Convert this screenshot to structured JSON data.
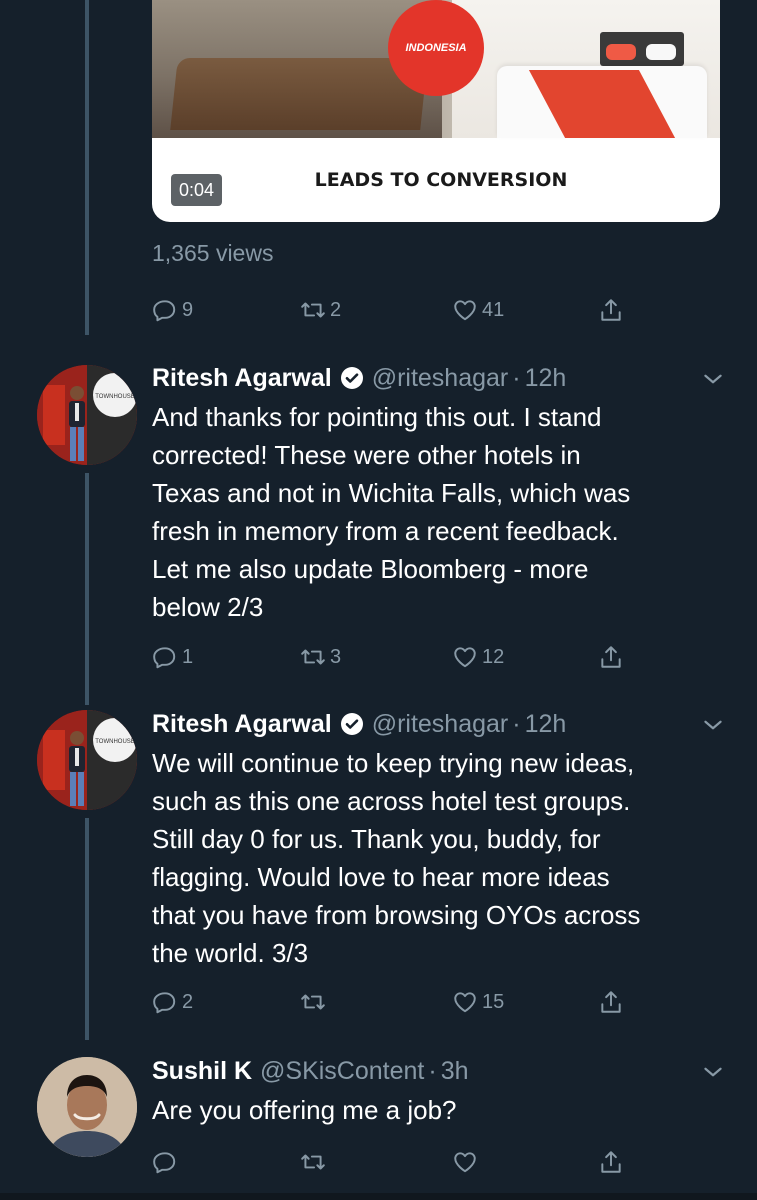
{
  "video": {
    "badge_text": "INDONESIA",
    "caption": "LEADS TO CONVERSION",
    "duration": "0:04",
    "views": "1,365 views"
  },
  "tweets": [
    {
      "replies": "9",
      "retweets": "2",
      "likes": "41"
    },
    {
      "name": "Ritesh Agarwal",
      "handle": "@riteshagar",
      "dot": "·",
      "time": "12h",
      "avatar_sign": "TOWNHOUSE",
      "text": "And thanks for pointing this out. I stand\ncorrected! These were other hotels in\nTexas and not in Wichita Falls, which was\nfresh in memory from a recent feedback.\nLet me also update Bloomberg - more\nbelow 2/3",
      "replies": "1",
      "retweets": "3",
      "likes": "12"
    },
    {
      "name": "Ritesh Agarwal",
      "handle": "@riteshagar",
      "dot": "·",
      "time": "12h",
      "avatar_sign": "TOWNHOUSE",
      "text": "We will continue to keep trying new ideas,\nsuch as this one across hotel test groups.\nStill day 0 for us. Thank you, buddy, for\nflagging. Would love to hear more ideas\nthat you have from browsing OYOs across\nthe world. 3/3",
      "replies": "2",
      "retweets": "",
      "likes": "15"
    },
    {
      "name": "Sushil K",
      "handle": "@SKisContent",
      "dot": "·",
      "time": "3h",
      "text": "Are you offering me a job?",
      "replies": "",
      "retweets": "",
      "likes": ""
    }
  ],
  "colors": {
    "background": "#15202b",
    "secondary_text": "#8899a6",
    "thread_line": "#3d5466",
    "badge_red": "#e3352a"
  },
  "icons": [
    "reply-icon",
    "retweet-icon",
    "like-icon",
    "share-icon",
    "verified-badge-icon",
    "caret-down-icon"
  ]
}
